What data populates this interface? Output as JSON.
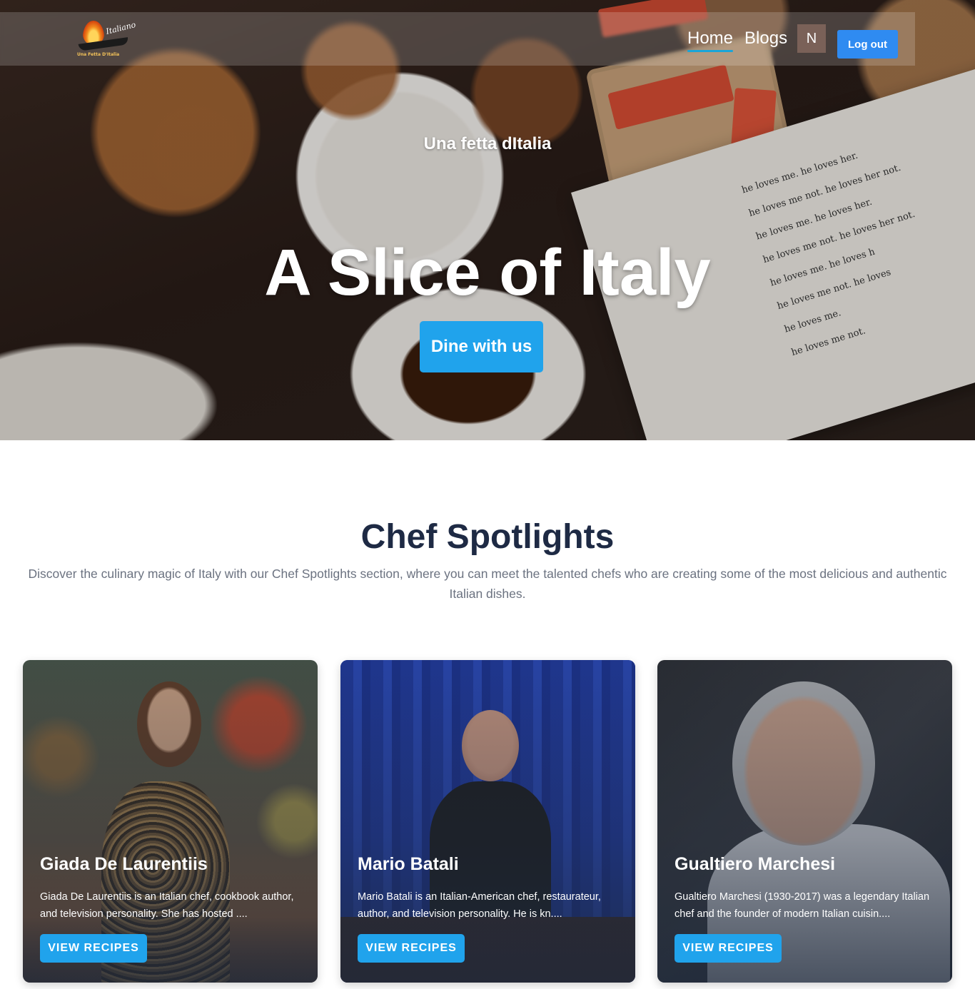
{
  "brand": {
    "logo_script": "Italiano",
    "logo_tag": "Una Fetta D'Italia"
  },
  "nav": {
    "links": [
      {
        "label": "Home",
        "active": true
      },
      {
        "label": "Blogs",
        "active": false
      }
    ],
    "avatar_initial": "N",
    "logout_label": "Log out"
  },
  "hero": {
    "subtitle": "Una fetta dItalia",
    "title": "A Slice of Italy",
    "cta_label": "Dine with us",
    "book_lines": [
      "he loves me.   he loves her.",
      "he loves me not.   he loves her not.",
      "he loves me.   he loves her.",
      "he loves me not.   he loves her not.",
      "he loves me.   he loves h",
      "he loves me not.   he loves",
      "he loves me.",
      "he loves me not."
    ]
  },
  "spotlight": {
    "title": "Chef Spotlights",
    "description": "Discover the culinary magic of Italy with our Chef Spotlights section, where you can meet the talented chefs who are creating some of the most delicious and authentic Italian dishes."
  },
  "chefs": [
    {
      "name": "Giada De Laurentiis",
      "bio": "Giada De Laurentiis is an Italian chef, cookbook author, and television personality. She has hosted ....",
      "button_label": "VIEW RECIPES"
    },
    {
      "name": "Mario Batali",
      "bio": "Mario Batali is an Italian-American chef, restaurateur, author, and television personality. He is kn....",
      "button_label": "VIEW RECIPES"
    },
    {
      "name": "Gualtiero Marchesi",
      "bio": "Gualtiero Marchesi (1930-2017) was a legendary Italian chef and the founder of modern Italian cuisin....",
      "button_label": "VIEW RECIPES"
    }
  ],
  "colors": {
    "accent_blue": "#20a3ec",
    "logout_blue": "#2f8bf1",
    "heading_navy": "#1e2a44",
    "muted_text": "#6b7280",
    "avatar_bg": "#7a6158",
    "active_underline": "#1aa5d8"
  }
}
